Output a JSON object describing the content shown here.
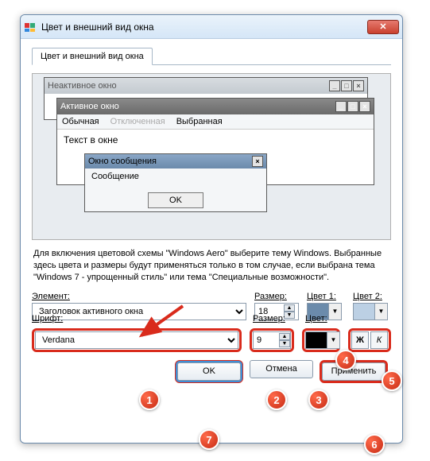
{
  "window": {
    "title": "Цвет и внешний вид окна"
  },
  "tab": {
    "label": "Цвет и внешний вид окна"
  },
  "preview": {
    "inactive_title": "Неактивное окно",
    "active_title": "Активное окно",
    "menu_normal": "Обычная",
    "menu_disabled": "Отключенная",
    "menu_selected": "Выбранная",
    "text_in_window": "Текст в окне",
    "msg_title": "Окно сообщения",
    "msg_body": "Сообщение",
    "ok": "OK"
  },
  "description": "Для включения цветовой схемы \"Windows Aero\" выберите тему Windows. Выбранные здесь цвета и размеры будут применяться только в том случае, если выбрана тема \"Windows 7 - упрощенный стиль\" или тема \"Специальные возможности\".",
  "labels": {
    "element": "Элемент:",
    "size": "Размер:",
    "color1": "Цвет 1:",
    "color2": "Цвет 2:",
    "font": "Шрифт:",
    "fontsize": "Размер:",
    "fontcolor": "Цвет:"
  },
  "values": {
    "element": "Заголовок активного окна",
    "element_size": "18",
    "color1": "#6b8bab",
    "color2": "#bcd0e4",
    "font": "Verdana",
    "font_size": "9",
    "font_color": "#000000",
    "bold": "Ж",
    "italic": "К"
  },
  "buttons": {
    "ok": "OK",
    "cancel": "Отмена",
    "apply": "Применить"
  },
  "badges": {
    "b1": "1",
    "b2": "2",
    "b3": "3",
    "b4": "4",
    "b5": "5",
    "b6": "6",
    "b7": "7"
  }
}
